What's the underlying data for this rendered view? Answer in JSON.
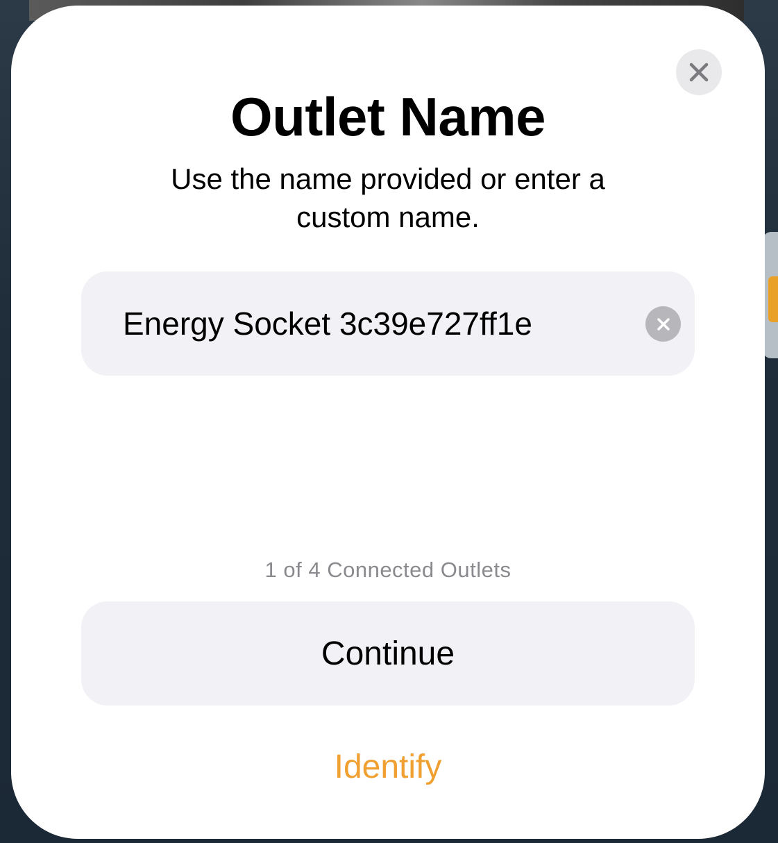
{
  "dialog": {
    "title": "Outlet Name",
    "subtitle": "Use the name provided or enter a custom name.",
    "close_icon": "close-icon",
    "name_field": {
      "value": "Energy Socket 3c39e727ff1e",
      "clear_icon": "clear-circle-icon"
    },
    "progress_text": "1 of 4 Connected Outlets",
    "continue_label": "Continue",
    "identify_label": "Identify"
  },
  "colors": {
    "accent": "#f0a030",
    "field_background": "#f1f1f6",
    "secondary_text": "#8a8a8e"
  }
}
